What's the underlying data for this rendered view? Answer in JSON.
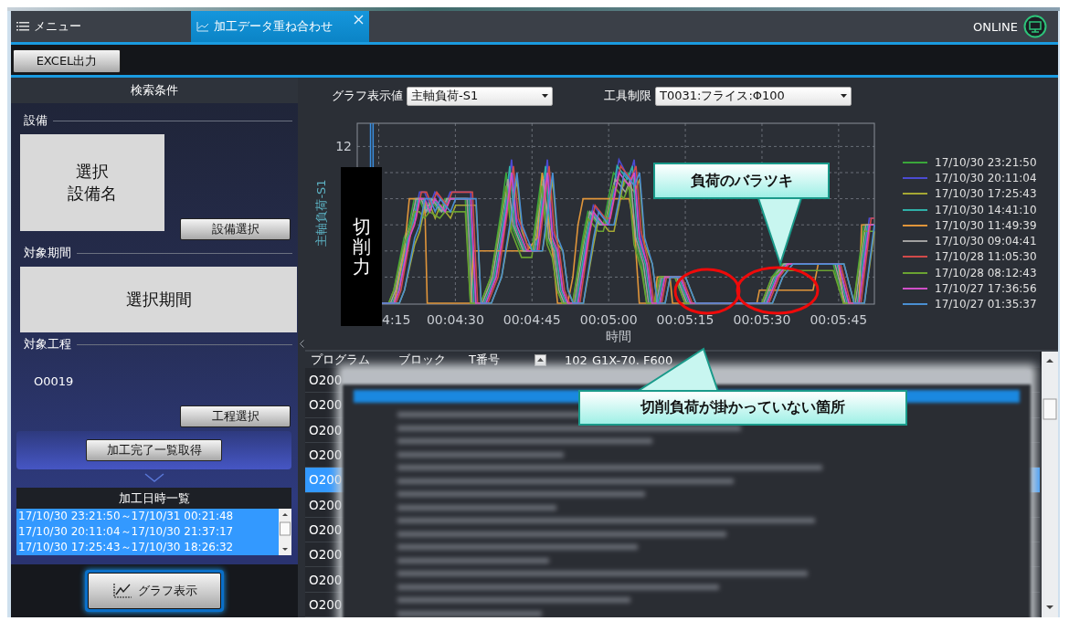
{
  "tabs": [
    {
      "label": "メニュー",
      "selected": false
    },
    {
      "label": "加工データ重ね合わせ",
      "selected": true
    }
  ],
  "connection_status": "ONLINE",
  "toolbar": {
    "buttons": [
      "EXCEL出力"
    ]
  },
  "search_panel": {
    "title": "検索条件",
    "equipment": {
      "label": "設備",
      "value_lines": [
        "選択",
        "設備名"
      ],
      "button": "設備選択"
    },
    "period": {
      "label": "対象期間",
      "value": "選択期間"
    },
    "process": {
      "label": "対象工程",
      "value": "O0019",
      "button": "工程選択"
    },
    "fetch_button": "加工完了一覧取得",
    "history": {
      "title": "加工日時一覧",
      "items": [
        {
          "text": "17/10/30 23:21:50～17/10/31 00:21:48",
          "selected": true
        },
        {
          "text": "17/10/30 20:11:04～17/10/30 21:37:17",
          "selected": true
        },
        {
          "text": "17/10/30 17:25:43～17/10/30 18:26:32",
          "selected": true
        }
      ]
    },
    "graph_button": "グラフ表示"
  },
  "graph_panel": {
    "filters": [
      {
        "label": "グラフ表示値",
        "value": "主軸負荷-S1"
      },
      {
        "label": "工具制限",
        "value": "T0031:フライス:Φ100"
      }
    ],
    "chart": {
      "ylabel": "主軸負荷-S1",
      "xlabel": "時間",
      "yticks": [
        "12"
      ],
      "xticks": [
        "4:15",
        "00:04:30",
        "00:04:45",
        "00:05:00",
        "00:05:15",
        "00:05:30",
        "00:05:45"
      ],
      "legend": [
        {
          "label": "17/10/30 23:21:50",
          "color": "#3aa63a"
        },
        {
          "label": "17/10/30 20:11:04",
          "color": "#4b4bd2"
        },
        {
          "label": "17/10/30 17:25:43",
          "color": "#a6a834"
        },
        {
          "label": "17/10/30 14:41:10",
          "color": "#2fb0a8"
        },
        {
          "label": "17/10/30 11:49:39",
          "color": "#e0953a"
        },
        {
          "label": "17/10/30 09:04:41",
          "color": "#a0a0a0"
        },
        {
          "label": "17/10/28 11:05:30",
          "color": "#d24a4a"
        },
        {
          "label": "17/10/28 08:12:43",
          "color": "#6aa232"
        },
        {
          "label": "17/10/27 17:36:56",
          "color": "#d04fc8"
        },
        {
          "label": "17/10/27 01:35:37",
          "color": "#4a8fd2"
        }
      ]
    }
  },
  "table": {
    "columns": [
      "プログラム",
      "ブロック",
      "T番号",
      "102",
      "G1X-70. F600"
    ],
    "rows": [
      {
        "cells": [
          "O200"
        ],
        "selected": false
      },
      {
        "cells": [
          "O200"
        ],
        "selected": false
      },
      {
        "cells": [
          "O200"
        ],
        "selected": false
      },
      {
        "cells": [
          "O200"
        ],
        "selected": false
      },
      {
        "cells": [
          "O200"
        ],
        "selected": true
      },
      {
        "cells": [
          "O200"
        ],
        "selected": false
      },
      {
        "cells": [
          "O200"
        ],
        "selected": false
      },
      {
        "cells": [
          "O200"
        ],
        "selected": false
      },
      {
        "cells": [
          "O200"
        ],
        "selected": false
      },
      {
        "cells": [
          "O200"
        ],
        "selected": false
      }
    ]
  },
  "annotations": [
    {
      "kind": "label",
      "text": "切削力"
    },
    {
      "kind": "callout",
      "text": "負荷のバラツキ"
    },
    {
      "kind": "callout",
      "text": "切削負荷が掛かっていない箇所"
    },
    {
      "kind": "circle"
    },
    {
      "kind": "circle"
    }
  ]
}
